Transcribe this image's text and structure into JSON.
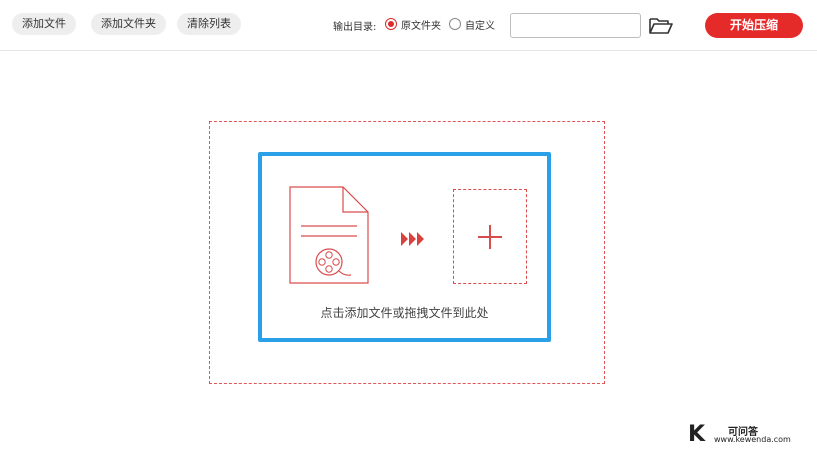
{
  "toolbar": {
    "add_file": "添加文件",
    "add_folder": "添加文件夹",
    "clear_list": "清除列表",
    "output_label": "输出目录:",
    "output_options": [
      {
        "label": "原文件夹",
        "checked": true
      },
      {
        "label": "自定义",
        "checked": false
      }
    ],
    "path_value": "",
    "folder_icon": "folder-open-icon",
    "start_button": "开始压缩"
  },
  "drop_zone": {
    "hint": "点击添加文件或拖拽文件到此处",
    "file_icon": "video-file-icon",
    "arrow_icon": "triple-arrow-icon",
    "add_icon": "plus-icon"
  },
  "watermark": {
    "logo": "K",
    "name": "可问答",
    "url": "www.kewenda.com"
  },
  "colors": {
    "accent": "#e52a2a",
    "drop_border": "#29a0e8",
    "dashed": "#e05555"
  }
}
